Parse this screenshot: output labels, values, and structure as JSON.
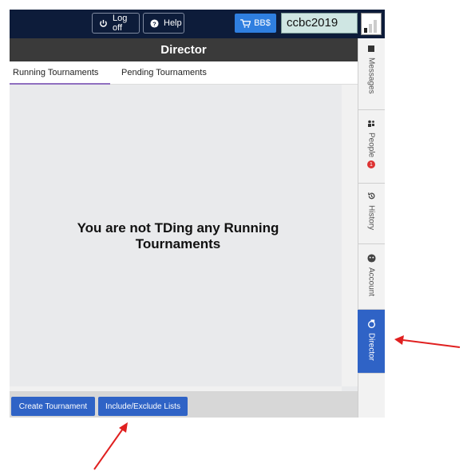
{
  "topbar": {
    "logoff_label": "Log off",
    "help_label": "Help",
    "bb_label": "BB$",
    "username": "ccbc2019"
  },
  "panel": {
    "title": "Director"
  },
  "tabs": [
    {
      "label": "Running Tournaments"
    },
    {
      "label": "Pending Tournaments"
    }
  ],
  "content": {
    "line1": "You are not TDing any Running",
    "line2": "Tournaments"
  },
  "buttons": {
    "create": "Create Tournament",
    "include_exclude": "Include/Exclude Lists"
  },
  "sidebar": {
    "items": [
      {
        "label": "Messages",
        "icon": "envelope-icon"
      },
      {
        "label": "People",
        "icon": "people-icon",
        "badge": "1"
      },
      {
        "label": "History",
        "icon": "history-icon"
      },
      {
        "label": "Account",
        "icon": "account-icon"
      },
      {
        "label": "Director",
        "icon": "director-icon"
      }
    ]
  },
  "colors": {
    "topbar": "#0d1c3a",
    "accent": "#2f63c6",
    "tab_indicator": "#8f6fbf",
    "annotation_arrow": "#e02020"
  }
}
